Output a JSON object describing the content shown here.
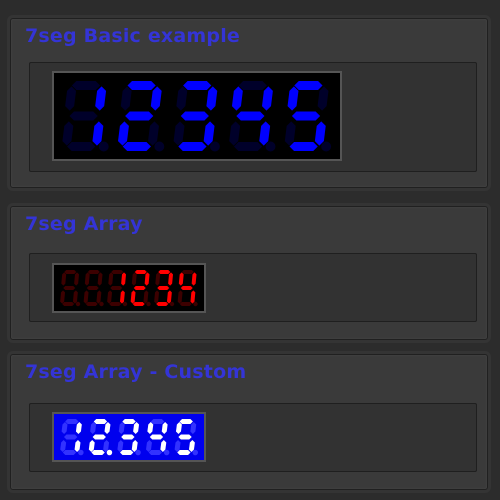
{
  "panels": [
    {
      "title": "7seg Basic example",
      "digits": [
        "1",
        "2",
        "3",
        "4",
        "5"
      ],
      "decimal_points": [
        false,
        false,
        false,
        false,
        false
      ],
      "on_color": "#0000ff",
      "off_color": "#00002a",
      "background": "#000000"
    },
    {
      "title": "7seg Array",
      "digits": [
        "8",
        "8",
        "1",
        "2",
        "3",
        "4"
      ],
      "lit": [
        false,
        false,
        true,
        true,
        true,
        true
      ],
      "decimal_points": [
        false,
        false,
        false,
        false,
        false,
        false
      ],
      "on_color": "#ff0000",
      "off_color": "#3c0000",
      "background": "#000000"
    },
    {
      "title": "7seg Array - Custom",
      "digits": [
        "1",
        "2",
        "3",
        "4",
        "5"
      ],
      "decimal_points": [
        false,
        true,
        false,
        false,
        false
      ],
      "on_color": "#ffffff",
      "off_color": "#3232ff",
      "background": "#0000ee"
    }
  ]
}
